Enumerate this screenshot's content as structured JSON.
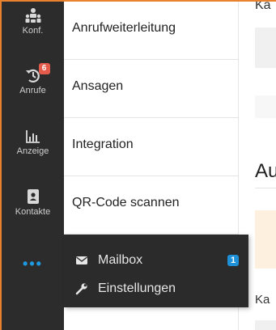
{
  "sidebar": {
    "items": [
      {
        "label": "Konf.",
        "icon": "conference-icon"
      },
      {
        "label": "Anrufe",
        "icon": "call-history-icon",
        "badge": "6"
      },
      {
        "label": "Anzeige",
        "icon": "chart-icon"
      },
      {
        "label": "Kontakte",
        "icon": "contacts-icon"
      }
    ],
    "more_label": "•••"
  },
  "menu": {
    "items": [
      {
        "label": "Anrufweiterleitung"
      },
      {
        "label": "Ansagen"
      },
      {
        "label": "Integration"
      },
      {
        "label": "QR-Code scannen"
      }
    ]
  },
  "popup": {
    "items": [
      {
        "label": "Mailbox",
        "icon": "envelope-icon",
        "count": "1"
      },
      {
        "label": "Einstellungen",
        "icon": "wrench-icon"
      }
    ]
  },
  "content": {
    "heading_fragment": "Au",
    "label_fragment": "Ka",
    "top_fragment": "Ka"
  },
  "colors": {
    "rail": "#2c2c2c",
    "accent": "#e8822e",
    "badge": "#e45b4b",
    "count": "#1e90d8",
    "dots": "#1e9be0"
  }
}
